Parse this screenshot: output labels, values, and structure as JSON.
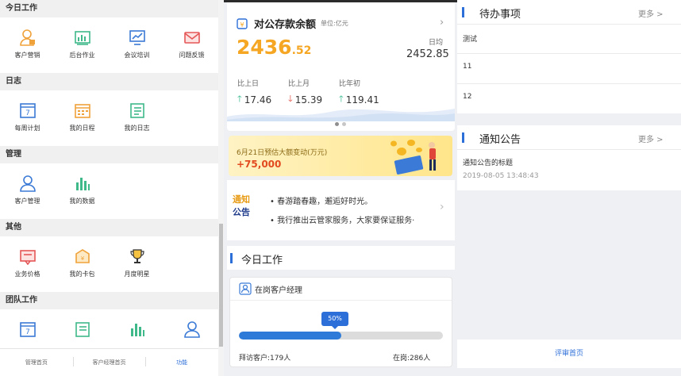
{
  "left_panel": {
    "sections": [
      {
        "title": "今日工作",
        "items": [
          {
            "label": "客户营销",
            "icon": "customer-marketing-icon"
          },
          {
            "label": "后台作业",
            "icon": "backend-job-icon"
          },
          {
            "label": "会议培训",
            "icon": "meeting-training-icon"
          },
          {
            "label": "问题反馈",
            "icon": "feedback-mail-icon"
          }
        ]
      },
      {
        "title": "日志",
        "items": [
          {
            "label": "每周计划",
            "icon": "weekly-calendar-icon"
          },
          {
            "label": "我的日程",
            "icon": "schedule-calendar-icon"
          },
          {
            "label": "我的日志",
            "icon": "log-list-icon"
          }
        ]
      },
      {
        "title": "管理",
        "items": [
          {
            "label": "客户管理",
            "icon": "customer-manage-icon"
          },
          {
            "label": "我的数据",
            "icon": "bar-chart-icon"
          }
        ]
      },
      {
        "title": "其他",
        "items": [
          {
            "label": "业务价格",
            "icon": "price-tag-icon"
          },
          {
            "label": "我的卡包",
            "icon": "card-wallet-icon"
          },
          {
            "label": "月度明星",
            "icon": "trophy-icon"
          }
        ]
      },
      {
        "title": "团队工作",
        "items": [
          {
            "label": "",
            "icon": "weekly-calendar-icon"
          },
          {
            "label": "",
            "icon": "log-list-icon"
          },
          {
            "label": "",
            "icon": "bar-chart-icon"
          },
          {
            "label": "",
            "icon": "customer-manage-icon"
          }
        ]
      }
    ],
    "bottom_tabs": [
      "管理首页",
      "客户经理首页",
      "功能"
    ],
    "active_tab": "功能"
  },
  "balance": {
    "title": "对公存款余额",
    "unit": "单位:亿元",
    "amount_int": "2436",
    "amount_dec": ".52",
    "daily_label": "日均",
    "daily_value": "2452.85",
    "comparisons": [
      {
        "label": "比上日",
        "value": "17.46",
        "direction": "up"
      },
      {
        "label": "比上月",
        "value": "15.39",
        "direction": "down"
      },
      {
        "label": "比年初",
        "value": "119.41",
        "direction": "up"
      }
    ],
    "carousel_pages": 2,
    "carousel_active": 0
  },
  "banner": {
    "text": "6月21日预估大额变动(万元)",
    "value": "+75,000"
  },
  "notice_ticker": {
    "logo_line1": "通知",
    "logo_line2": "公告",
    "lines": [
      "春游踏春趣，邂逅好时光。",
      "我行推出云管家服务，大家要保证服务·"
    ]
  },
  "today_work": {
    "title": "今日工作",
    "manager_title": "在岗客户经理",
    "progress_percent": 50,
    "progress_label": "50%",
    "visit_label": "拜访客户:179人",
    "on_duty_label": "在岗:286人"
  },
  "todo": {
    "title": "待办事项",
    "more": "更多 >",
    "items": [
      "测试",
      "11",
      "12"
    ]
  },
  "announcements": {
    "title": "通知公告",
    "more": "更多 >",
    "items": [
      {
        "title": "通知公告的标题",
        "time": "2019-08-05 13:48:43"
      }
    ]
  },
  "review_link": "评审首页",
  "colors": {
    "accent": "#2d6fd8",
    "amount": "#f5a623",
    "up": "#2eb688",
    "down": "#e0453a",
    "banner_value": "#e24a1f"
  }
}
